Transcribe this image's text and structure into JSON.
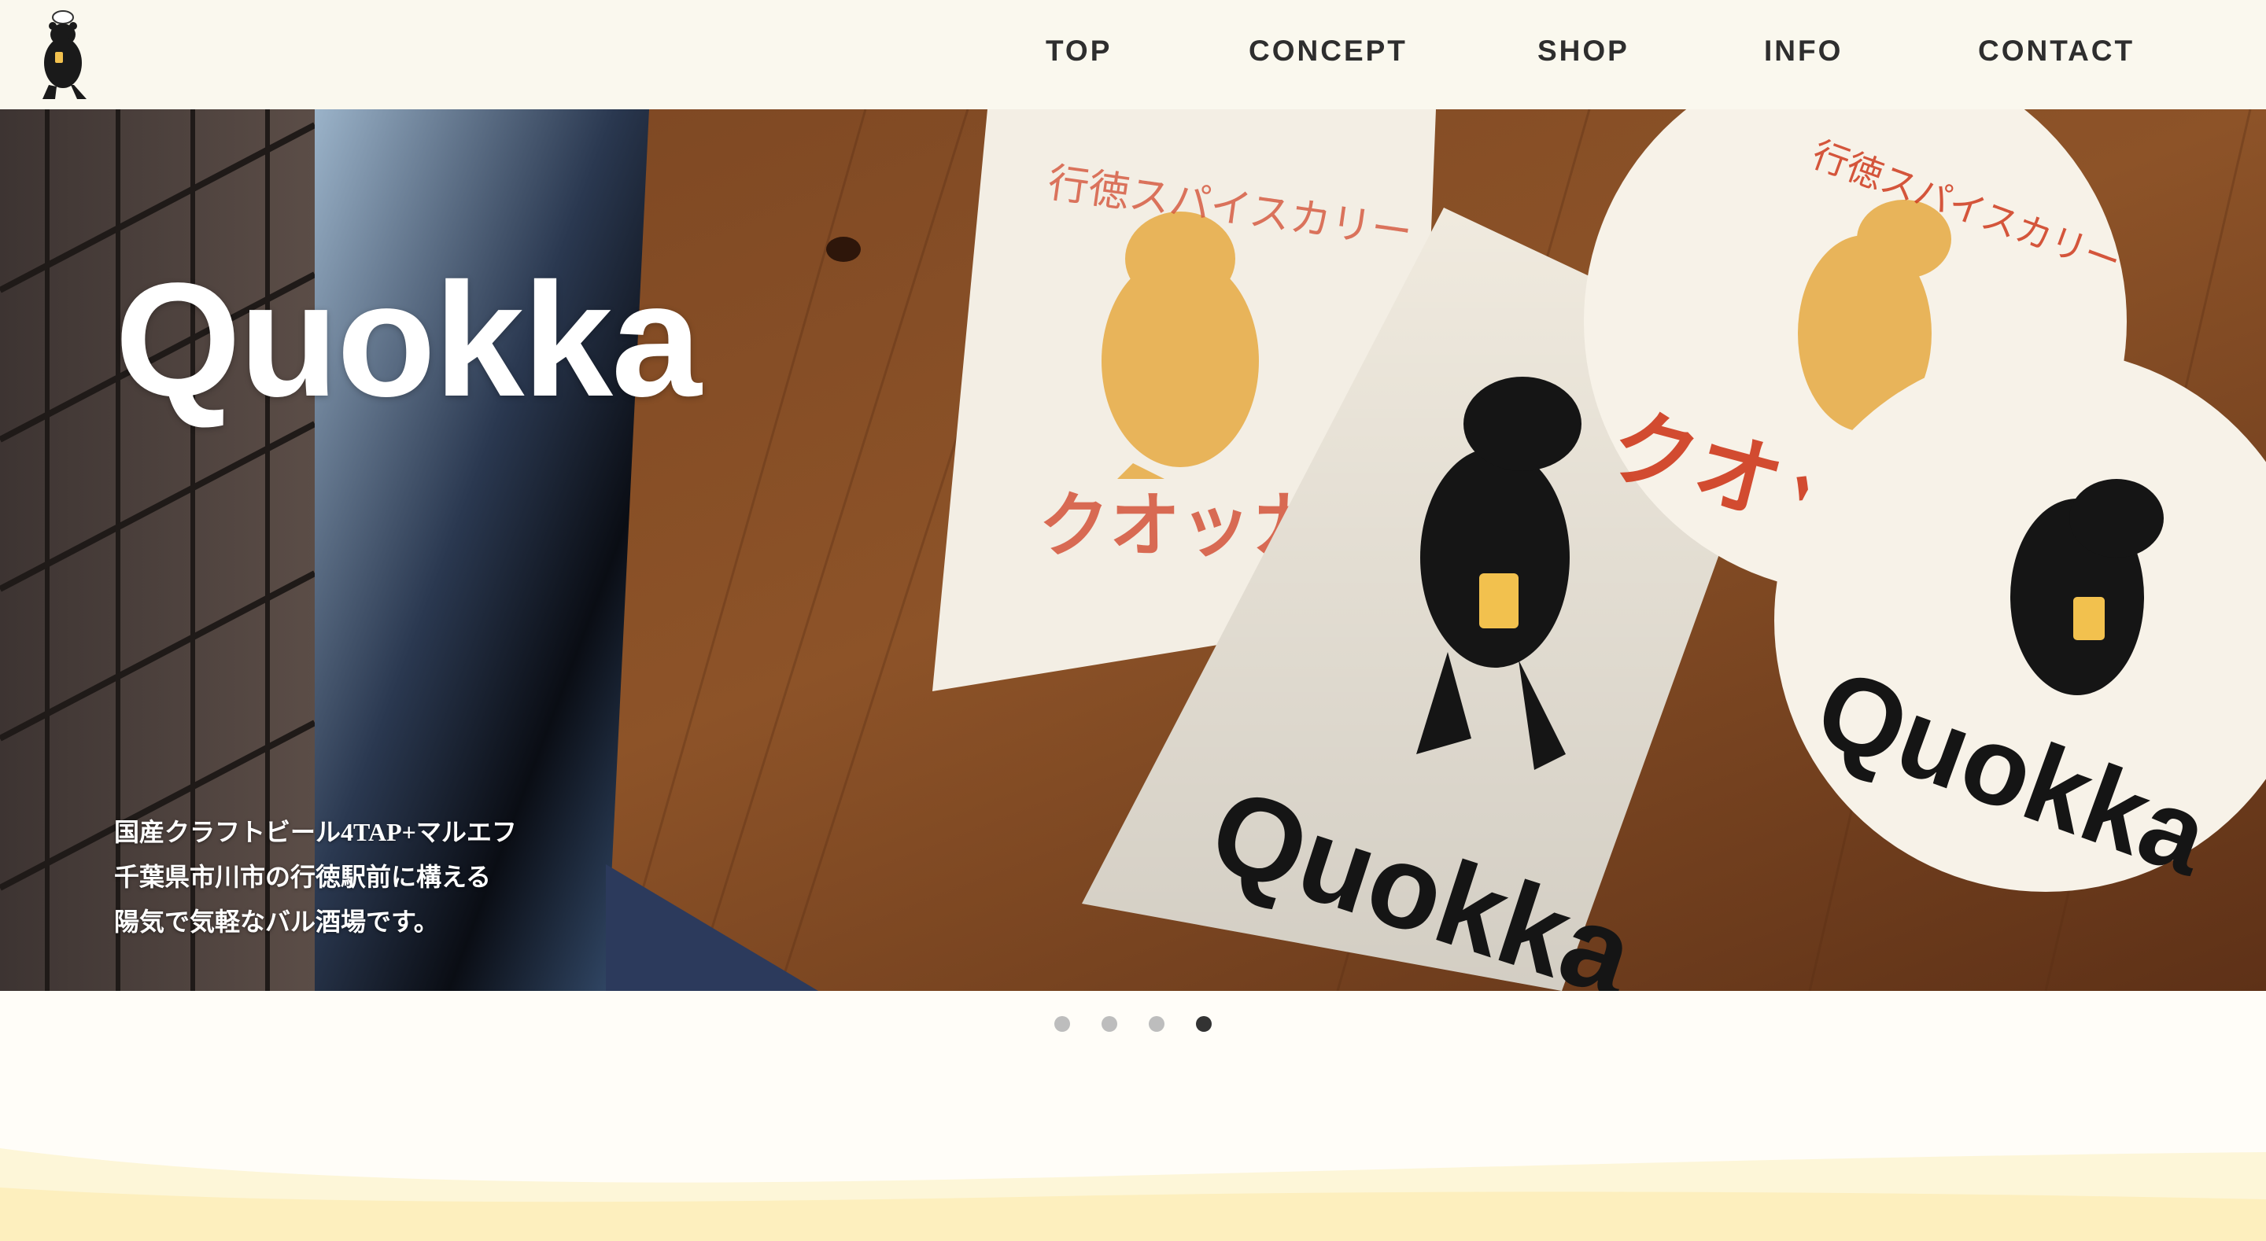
{
  "header": {
    "logo_alt": "Quokka bear logo",
    "nav": [
      {
        "label": "TOP"
      },
      {
        "label": "CONCEPT"
      },
      {
        "label": "SHOP"
      },
      {
        "label": "INFO"
      },
      {
        "label": "CONTACT"
      }
    ]
  },
  "hero": {
    "title": "Quokka",
    "copy_lines": [
      "国産クラフトビール4TAP+マルエフ",
      "千葉県市川市の行徳駅前に構える",
      "陽気で気軽なバル酒場です。"
    ],
    "sticker_text_1": "Quokka",
    "sticker_text_2": "Quokka",
    "sticker_jp_1": "行徳スパイスカリー",
    "sticker_jp_2": "クオッカ"
  },
  "slider": {
    "dots": 4,
    "active_index": 3
  },
  "colors": {
    "header_bg": "#faf8ee",
    "nav_text": "#2e2e2e",
    "page_bg": "#fffdf8",
    "wave": "#fdf0bf",
    "dot_active": "#333333",
    "dot_inactive": "#bdbdbd"
  }
}
